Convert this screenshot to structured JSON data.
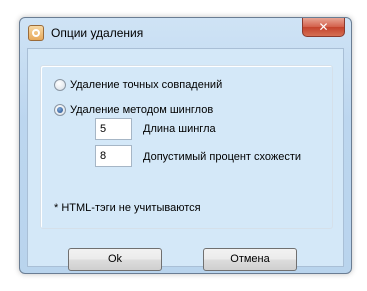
{
  "window": {
    "title": "Опции удаления",
    "close_glyph": "✕"
  },
  "options": {
    "exact_label": "Удаление точных совпадений",
    "exact_checked": false,
    "shingle_label": "Удаление методом шинглов",
    "shingle_checked": true
  },
  "fields": {
    "shingle_length_value": "5",
    "shingle_length_label": "Длина шингла",
    "similarity_value": "8",
    "similarity_label": "Допустимый процент схожести"
  },
  "note": "* HTML-тэги не учитываются",
  "buttons": {
    "ok": "Ok",
    "cancel": "Отмена"
  }
}
